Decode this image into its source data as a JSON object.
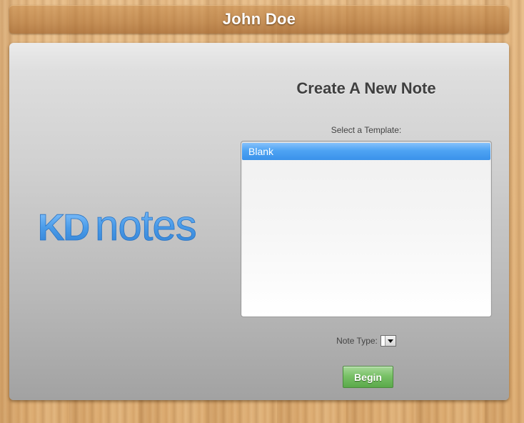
{
  "header": {
    "title": "John Doe"
  },
  "logo": {
    "text_kd": "KD",
    "text_notes": "notes",
    "color": "#4a9be8"
  },
  "form": {
    "title": "Create A New Note",
    "template_label": "Select a Template:",
    "templates": [
      {
        "label": "Blank",
        "selected": true
      }
    ],
    "note_type_label": "Note Type:",
    "note_type_value": "",
    "begin_label": "Begin"
  },
  "colors": {
    "selection": "#4ea3f3",
    "begin_button": "#6bb85a",
    "panel": "#d0d0d0",
    "wood": "#e0b27a"
  }
}
